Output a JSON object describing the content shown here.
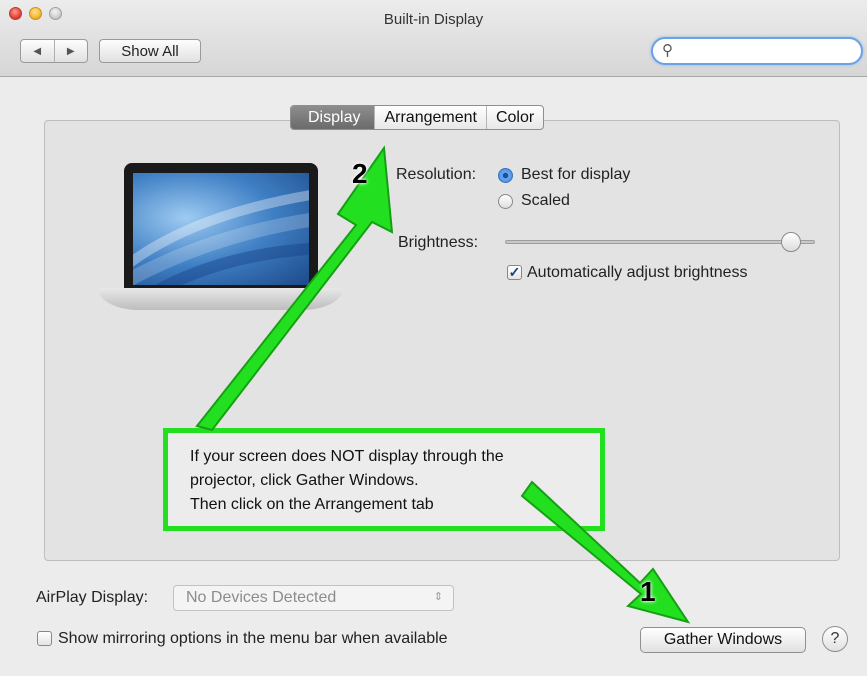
{
  "window": {
    "title": "Built-in Display",
    "show_all": "Show All",
    "nav_back": "◀",
    "nav_forward": "▶",
    "search_placeholder": ""
  },
  "tabs": [
    "Display",
    "Arrangement",
    "Color"
  ],
  "active_tab": "Display",
  "display": {
    "resolution_label": "Resolution:",
    "resolution_options": [
      "Best for display",
      "Scaled"
    ],
    "resolution_selected": "Best for display",
    "brightness_label": "Brightness:",
    "brightness_level": 0.92,
    "auto_brightness_label": "Automatically adjust brightness",
    "auto_brightness_checked": true
  },
  "airplay": {
    "label": "AirPlay Display:",
    "value": "No Devices Detected"
  },
  "mirroring_option": {
    "label": "Show mirroring options in the menu bar when available",
    "checked": false
  },
  "buttons": {
    "gather_windows": "Gather Windows",
    "help": "?"
  },
  "annotation": {
    "text_lines": [
      "If your screen does NOT display through the",
      "projector, click Gather Windows.",
      "Then click on the Arrangement tab"
    ],
    "step1": "1",
    "step2": "2",
    "color": "#22e020"
  }
}
